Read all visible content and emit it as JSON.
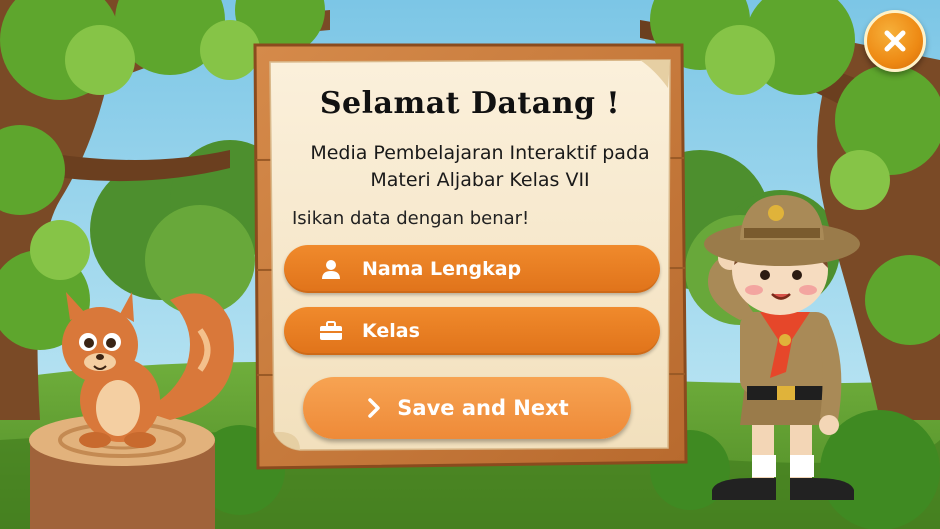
{
  "header": {
    "close_icon": "close-icon",
    "accent_color": "#ee8a14"
  },
  "board": {
    "title": "Selamat Datang !",
    "subtitle_line1": "Media Pembelajaran Interaktif pada",
    "subtitle_line2": "Materi Aljabar Kelas VII",
    "instruction": "Isikan data dengan benar!"
  },
  "form": {
    "name_field": {
      "label": "Nama Lengkap",
      "icon": "user-icon"
    },
    "class_field": {
      "label": "Kelas",
      "icon": "briefcase-icon"
    },
    "save_button": {
      "label": "Save and Next",
      "icon": "chevron-right-icon"
    },
    "field_color": "#e97f24"
  }
}
